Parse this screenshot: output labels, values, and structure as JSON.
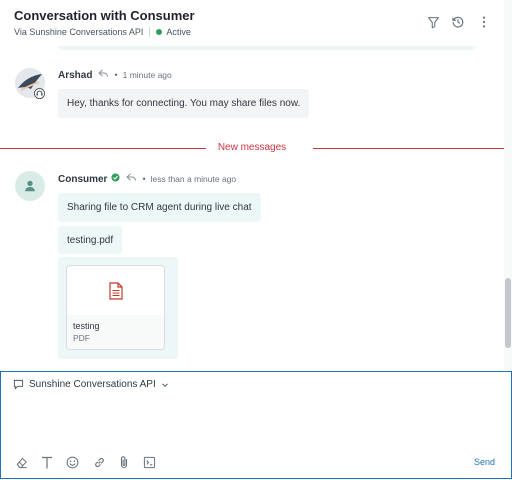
{
  "header": {
    "title": "Conversation with Consumer",
    "channel": "Via Sunshine Conversations API",
    "status": "Active",
    "icons": [
      "filter-icon",
      "history-icon",
      "more-vertical-icon"
    ]
  },
  "messages": [
    {
      "author": "Arshad",
      "role": "agent",
      "time": "1 minute ago",
      "text": "Hey, thanks for connecting. You may share files now."
    }
  ],
  "divider_label": "New messages",
  "consumer": {
    "author": "Consumer",
    "time": "less than a minute ago",
    "text": "Sharing file to CRM agent during live chat",
    "file_text": "testing.pdf",
    "attachment": {
      "name": "testing",
      "type": "PDF"
    }
  },
  "composer": {
    "channel": "Sunshine Conversations API",
    "send_label": "Send",
    "tools": [
      "eraser-icon",
      "text-format-icon",
      "emoji-icon",
      "link-icon",
      "attachment-icon",
      "macro-icon"
    ]
  },
  "colors": {
    "accent": "#1f73b7",
    "divider": "#cc3340",
    "active": "#2f9e5f",
    "customer_bubble": "#eef7f8",
    "agent_bubble": "#f3f4f5",
    "pdf_icon": "#c0392b"
  }
}
